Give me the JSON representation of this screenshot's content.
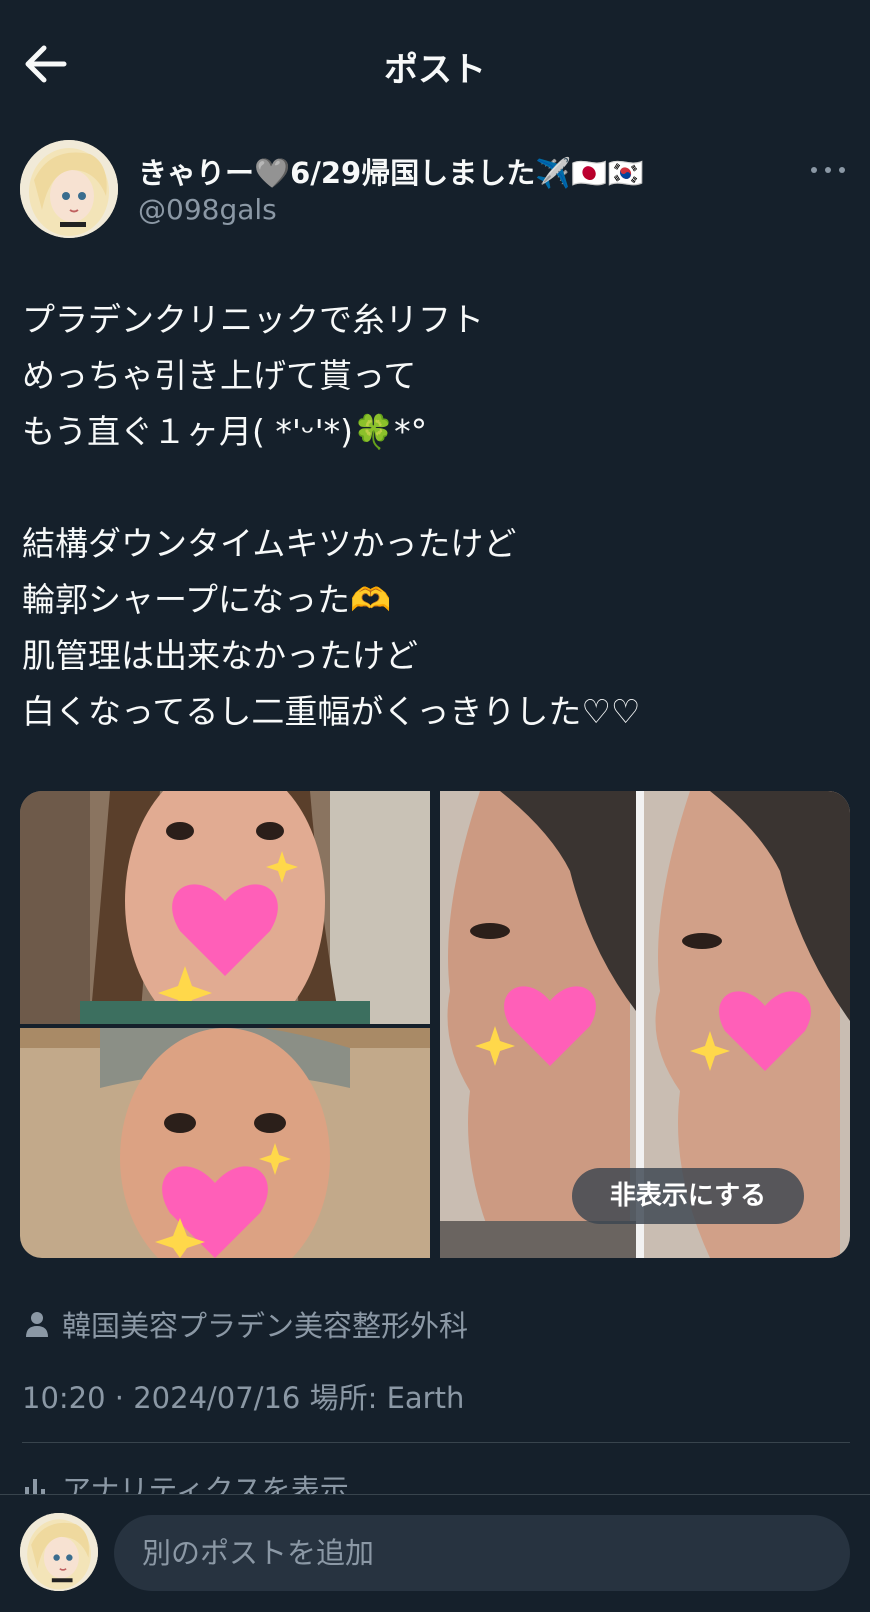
{
  "header": {
    "title": "ポスト"
  },
  "author": {
    "display_name": "きゃりー🩶6/29帰国しました✈️🇯🇵🇰🇷",
    "handle": "@098gals"
  },
  "post": {
    "paragraphs": [
      [
        "プラデンクリニックで糸リフト",
        "めっちゃ引き上げて貰って",
        "もう直ぐ１ヶ月( *'ᵕ'*)🍀*°"
      ],
      [
        "結構ダウンタイムキツかったけど",
        "輪郭シャープになった🫶",
        "肌管理は出来なかったけど",
        "白くなってるし二重幅がくっきりした♡♡"
      ]
    ]
  },
  "media": {
    "hide_label": "非表示にする"
  },
  "meta": {
    "location": "韓国美容プラデン美容整形外科",
    "timestamp": "10:20 · 2024/07/16 場所: Earth",
    "analytics": "アナリティクスを表示"
  },
  "reply": {
    "placeholder": "別のポストを追加"
  },
  "colors": {
    "background": "#15202b",
    "secondary_text": "#8b98a5",
    "divider": "#38444d"
  }
}
